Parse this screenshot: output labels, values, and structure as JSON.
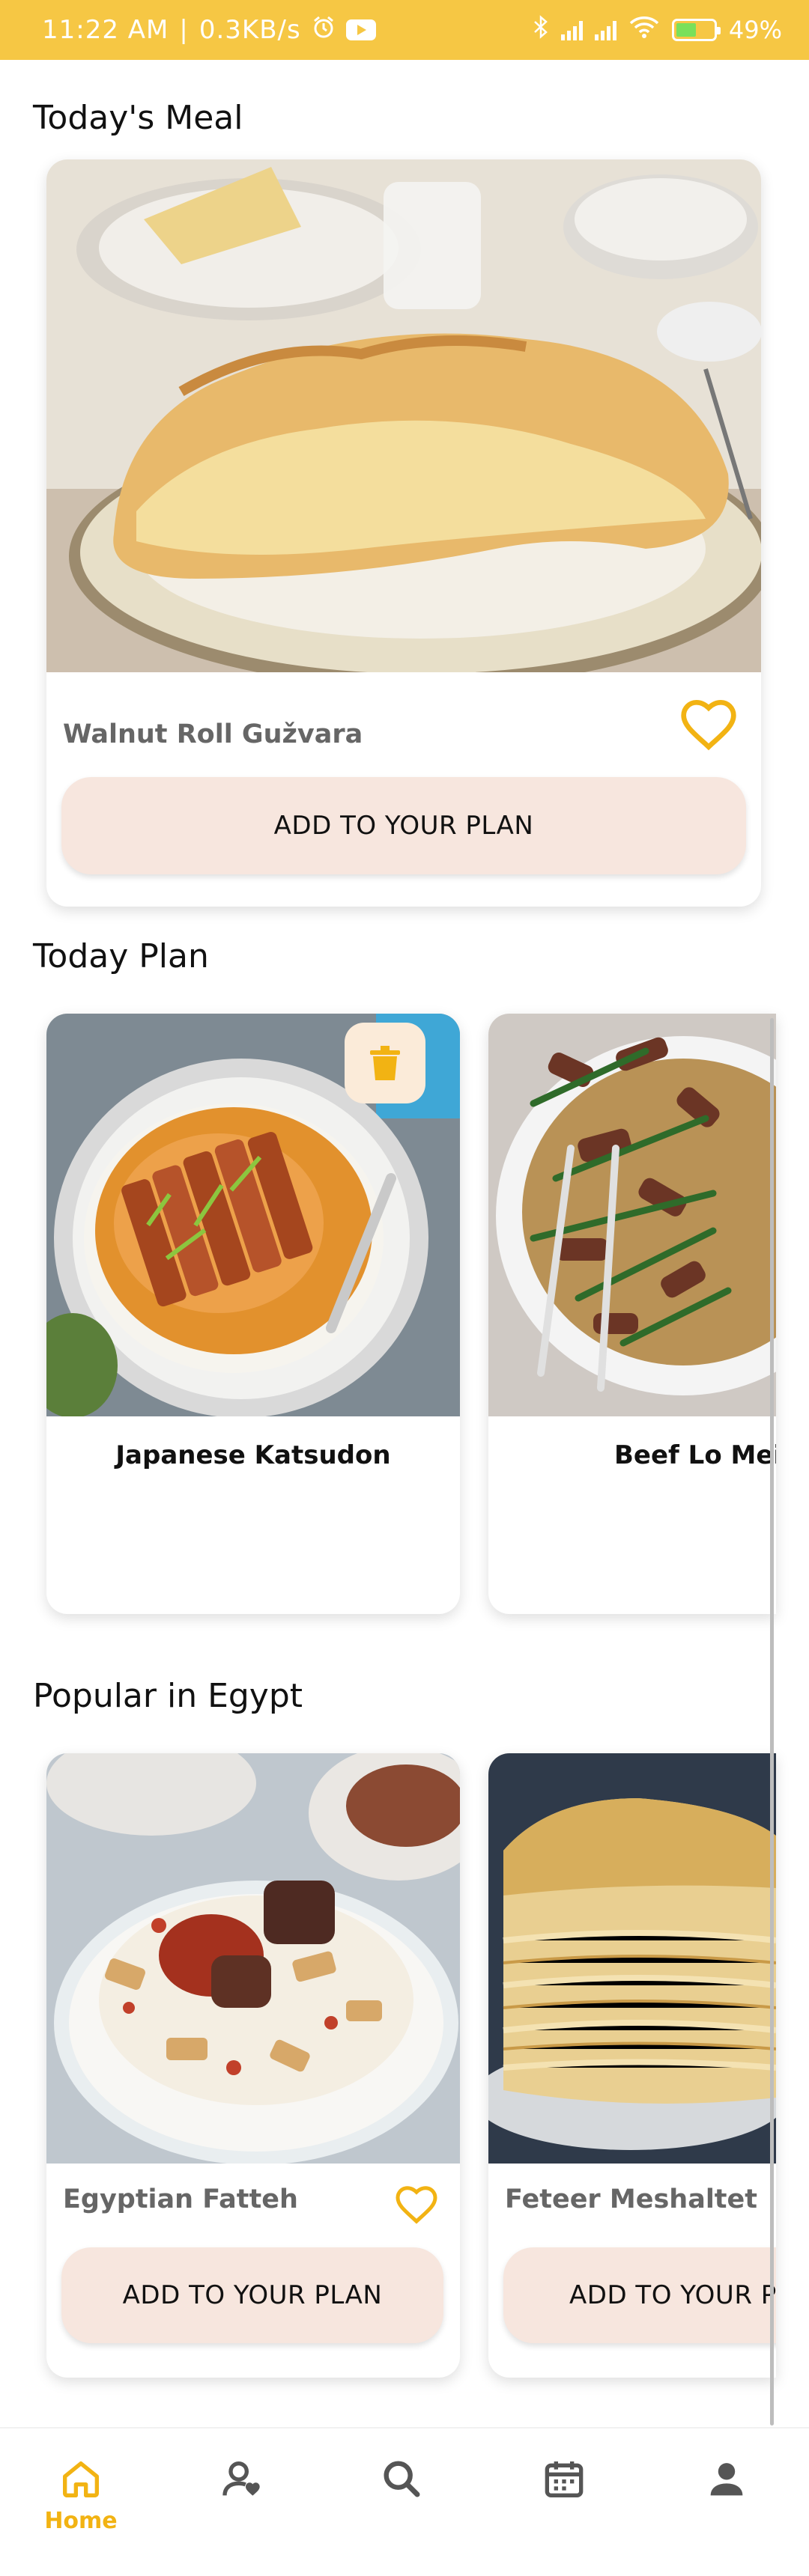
{
  "status_bar": {
    "time": "11:22 AM",
    "speed": "0.3KB/s",
    "battery": "49%",
    "background": "#F6C744"
  },
  "todays_meal": {
    "section_title": "Today's Meal",
    "meal_name": "Walnut Roll Gužvara",
    "button_label": "ADD TO YOUR PLAN",
    "favorite_icon": "heart-outline-icon"
  },
  "today_plan": {
    "section_title": "Today Plan",
    "items": [
      {
        "name": "Japanese Katsudon",
        "action_icon": "trash-icon"
      },
      {
        "name": "Beef Lo Mein"
      }
    ]
  },
  "popular": {
    "section_title": "Popular in Egypt",
    "items": [
      {
        "name": "Egyptian Fatteh",
        "button_label": "ADD TO YOUR PLAN",
        "favorite_icon": "heart-outline-icon"
      },
      {
        "name": "Feteer Meshaltet",
        "button_label": "ADD TO YOUR PLAN"
      }
    ]
  },
  "bottom_nav": {
    "items": [
      {
        "icon": "home-icon",
        "label": "Home",
        "active": true
      },
      {
        "icon": "favorite-user-icon"
      },
      {
        "icon": "search-icon"
      },
      {
        "icon": "calendar-icon"
      },
      {
        "icon": "profile-icon"
      }
    ]
  },
  "colors": {
    "accent": "#F2B313",
    "button_bg": "#F7E6DE",
    "inactive_icon": "#555555"
  }
}
